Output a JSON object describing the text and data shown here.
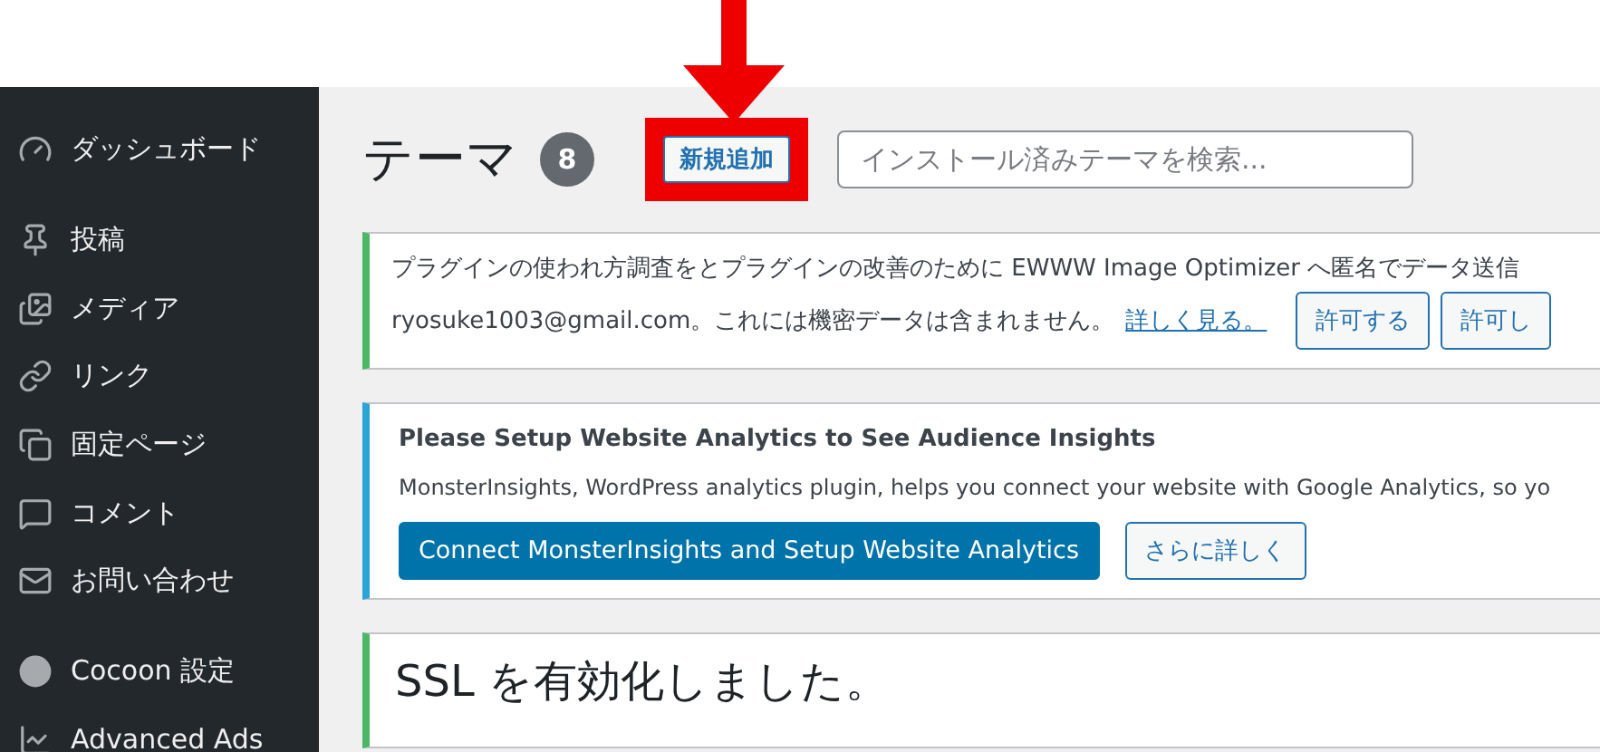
{
  "sidebar": {
    "groups": [
      [
        {
          "label": "ダッシュボード"
        }
      ],
      [
        {
          "label": "投稿"
        },
        {
          "label": "メディア"
        },
        {
          "label": "リンク"
        },
        {
          "label": "固定ページ"
        },
        {
          "label": "コメント"
        },
        {
          "label": "お問い合わせ"
        }
      ],
      [
        {
          "label": "Cocoon 設定"
        },
        {
          "label": "Advanced Ads"
        }
      ]
    ]
  },
  "header": {
    "title": "テーマ",
    "count": "8",
    "add_button": {
      "label": "新規追加",
      "highlighted": true
    },
    "search": {
      "placeholder": "インストール済みテーマを検索..."
    }
  },
  "notices": [
    {
      "kind": "consent",
      "color": "#4ab866",
      "text": "プラグインの使われ方調査をとプラグインの改善のために EWWW Image Optimizer へ匿名でデータ送信",
      "email": "ryosuke1003@gmail.com。これには機密データは含まれません。",
      "link": "詳しく見る。",
      "buttons": [
        "許可する",
        "許可し"
      ]
    },
    {
      "kind": "setup",
      "color": "#2aa5d8",
      "title": "Please Setup Website Analytics to See Audience Insights",
      "text": "MonsterInsights, WordPress analytics plugin, helps you connect your website with Google Analytics, so yo",
      "primary_button": "Connect MonsterInsights and Setup Website Analytics",
      "secondary_button": "さらに詳しく"
    },
    {
      "kind": "success",
      "color": "#4ab866",
      "text": "SSL を有効化しました。"
    }
  ]
}
